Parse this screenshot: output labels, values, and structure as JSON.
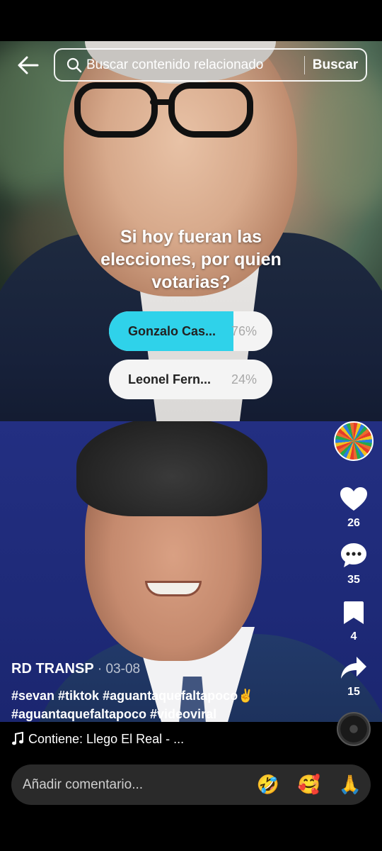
{
  "search": {
    "placeholder": "Buscar contenido relacionado",
    "button_label": "Buscar"
  },
  "poll": {
    "question": "Si hoy fueran las elecciones, por quien votarias?",
    "options": [
      {
        "label": "Gonzalo Cas...",
        "percent_text": "76%",
        "percent": 76
      },
      {
        "label": "Leonel Fern...",
        "percent_text": "24%",
        "percent": 24
      }
    ],
    "fill_color": "#2fd2ea"
  },
  "actions": {
    "likes": "26",
    "comments": "35",
    "saves": "4",
    "shares": "15"
  },
  "post": {
    "author": "RD TRANSP",
    "date": "· 03-08",
    "hashtags_line1": "#sevan #tiktok #aguantaquefaltapoco✌️",
    "hashtags_line2": "#aguantaquefaltapoco #videoviral"
  },
  "music": {
    "text": "Contiene: Llego El Real - ..."
  },
  "comment": {
    "placeholder": "Añadir comentario...",
    "emojis": [
      "🤣",
      "🥰",
      "🙏"
    ]
  },
  "icons": [
    "back-arrow-icon",
    "search-icon",
    "heart-icon",
    "comment-bubble-icon",
    "bookmark-icon",
    "share-arrow-icon",
    "music-note-icon"
  ]
}
